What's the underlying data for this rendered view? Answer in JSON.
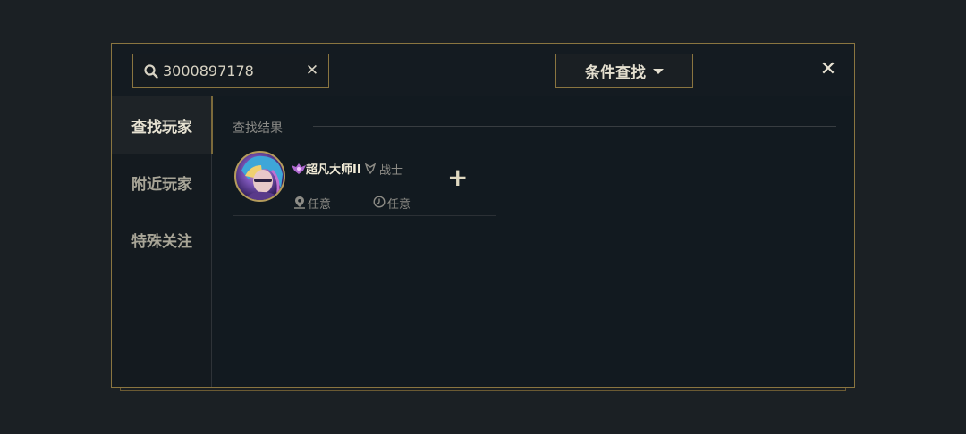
{
  "search": {
    "value": "3000897178",
    "placeholder": ""
  },
  "header": {
    "filter_label": "条件查找"
  },
  "sidebar": {
    "items": [
      {
        "label": "查找玩家",
        "active": true
      },
      {
        "label": "附近玩家",
        "active": false
      },
      {
        "label": "特殊关注",
        "active": false
      }
    ]
  },
  "results": {
    "title": "查找结果",
    "players": [
      {
        "name": "超凡大师II",
        "role": "战士",
        "location": "任意",
        "time": "任意"
      }
    ]
  },
  "colors": {
    "accent": "#8a7540",
    "background": "#121a20",
    "text_primary": "#e6e1d1",
    "text_secondary": "#8d8c86"
  },
  "icons": {
    "search": "search-icon",
    "clear": "clear-icon",
    "close": "close-icon",
    "add": "add-friend-icon",
    "location": "location-icon",
    "time": "clock-icon",
    "rank": "rank-badge-icon",
    "role": "role-icon"
  }
}
